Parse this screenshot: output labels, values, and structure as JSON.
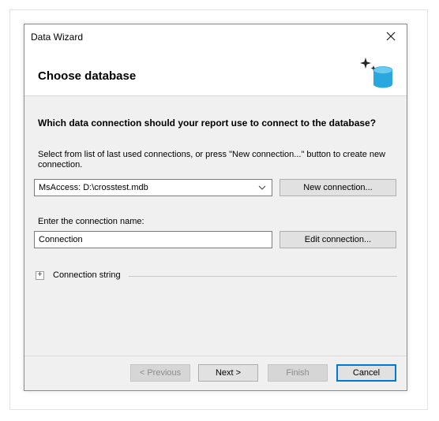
{
  "window": {
    "title": "Data Wizard"
  },
  "header": {
    "title": "Choose database",
    "icon": "database-sparkle-icon"
  },
  "body": {
    "question": "Which data connection should your report use to connect to the database?",
    "instruction": "Select from list of last used connections, or press \"New connection...\" button to create new connection.",
    "connection_select": {
      "selected": "MsAccess: D:\\crosstest.mdb"
    },
    "new_connection_label": "New connection...",
    "name_label": "Enter the connection name:",
    "name_value": "Connection",
    "edit_connection_label": "Edit connection...",
    "expander": {
      "symbol": "+",
      "label": "Connection string"
    }
  },
  "footer": {
    "prev_label": "< Previous",
    "next_label": "Next >",
    "finish_label": "Finish",
    "cancel_label": "Cancel"
  },
  "colors": {
    "accent": "#0078d7",
    "icon_blue": "#29a8e0"
  }
}
